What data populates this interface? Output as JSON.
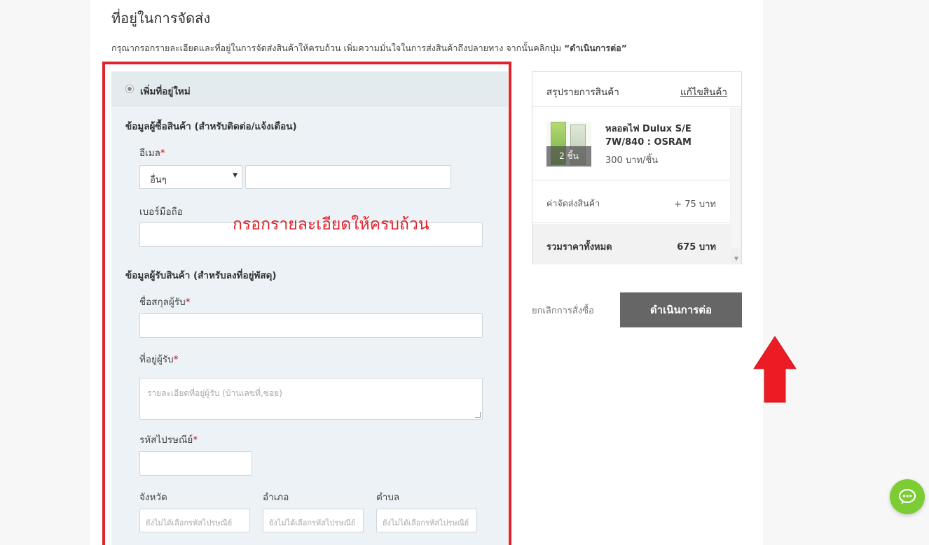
{
  "page": {
    "title": "ที่อยู่ในการจัดส่ง",
    "description_prefix": "กรุณากรอกรายละเอียดและที่อยู่ในการจัดส่งสินค้าให้ครบถ้วน เพิ่มความมั่นใจในการส่งสินค้าถึงปลายทาง จากนั้นคลิกปุ่ม ",
    "description_button": "“ดำเนินการต่อ”"
  },
  "form": {
    "new_address_label": "เพิ่มที่อยู่ใหม่",
    "buyer_section": "ข้อมูลผู้ซื้อสินค้า (สำหรับติดต่อ/แจ้งเตือน)",
    "email_label": "อีเมล",
    "email_domain_selected": "อื่นๆ",
    "email_value": "",
    "mobile_label": "เบอร์มือถือ",
    "mobile_value": "",
    "recipient_section": "ข้อมูลผู้รับสินค้า (สำหรับลงที่อยู่พัสดุ)",
    "name_label": "ชื่อสกุลผู้รับ",
    "name_value": "",
    "address_label": "ที่อยู่ผู้รับ",
    "address_placeholder": "รายละเอียดที่อยู่ผู้รับ (บ้านเลขที่,ซอย)",
    "postcode_label": "รหัสไปรษณีย์",
    "postcode_value": "",
    "province_label": "จังหวัด",
    "district_label": "อำเภอ",
    "subdistrict_label": "ตำบล",
    "province_placeholder": "ยังไม่ได้เลือกรหัสไปรษณีย์",
    "district_placeholder": "ยังไม่ได้เลือกรหัสไปรษณีย์",
    "subdistrict_placeholder": "ยังไม่ได้เลือกรหัสไปรษณีย์",
    "required_mark": "*"
  },
  "annotation": {
    "text": "กรอกรายละเอียดให้ครบถ้วน",
    "color": "#e0222a"
  },
  "summary": {
    "title": "สรุปรายการสินค้า",
    "edit_link": "แก้ไขสินค้า",
    "product": {
      "name": "หลอดไฟ Dulux S/E 7W/840 : OSRAM",
      "price": "300 บาท/ชิ้น",
      "quantity": "2 ชิ้น"
    },
    "shipping_label": "ค่าจัดส่งสินค้า",
    "shipping_value": "+ 75 บาท",
    "total_label": "รวมราคาทั้งหมด",
    "total_value": "675 บาท"
  },
  "actions": {
    "cancel": "ยกเลิกการสั่งซื้อ",
    "continue": "ดำเนินการต่อ"
  },
  "colors": {
    "accent_red": "#e0222a",
    "button_gray": "#666666",
    "chat_green": "#7ccd34"
  }
}
